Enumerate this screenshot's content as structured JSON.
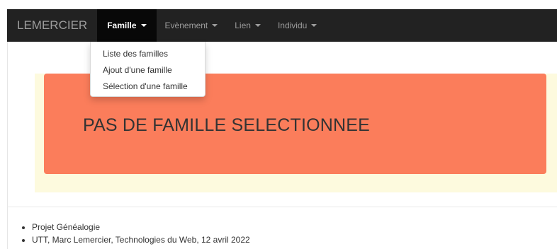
{
  "navbar": {
    "brand": "LEMERCIER",
    "items": [
      {
        "label": "Famille",
        "active": true
      },
      {
        "label": "Evènement",
        "active": false
      },
      {
        "label": "Lien",
        "active": false
      },
      {
        "label": "Individu",
        "active": false
      }
    ]
  },
  "dropdown": {
    "items": [
      {
        "label": "Liste des familles"
      },
      {
        "label": "Ajout d'une famille"
      },
      {
        "label": "Sélection d'une famille"
      }
    ]
  },
  "alert": {
    "text": "PAS DE FAMILLE SELECTIONNEE"
  },
  "footer": {
    "items": [
      {
        "text": "Projet Généalogie"
      },
      {
        "text": "UTT, Marc Lemercier, Technologies du Web, 12 avril 2022"
      }
    ]
  },
  "colors": {
    "navbar_bg": "#222222",
    "active_bg": "#080808",
    "alert_bg": "#fb7d5b",
    "panel_bg": "#fdfade"
  }
}
